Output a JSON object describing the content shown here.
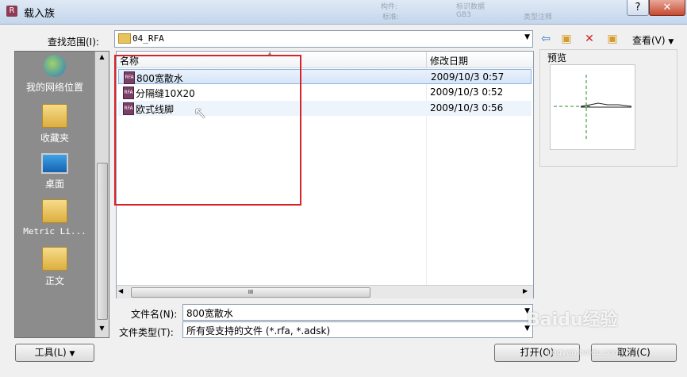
{
  "window": {
    "title": "载入族",
    "help_label": "?",
    "close_label": "✕",
    "background_text": [
      "构件:",
      "标识数据",
      "类型注释",
      "标准:",
      "GB3"
    ]
  },
  "toolbar": {
    "lookin_label": "查找范围(I):",
    "lookin_value": "04_RFA",
    "views_label": "查看(V)",
    "icons": [
      "back-icon",
      "up-folder-icon",
      "delete-icon",
      "new-folder-icon"
    ]
  },
  "places": [
    {
      "label": "我的网络位置",
      "icon": "network-globe-icon"
    },
    {
      "label": "收藏夹",
      "icon": "favorites-folder-icon"
    },
    {
      "label": "桌面",
      "icon": "desktop-monitor-icon"
    },
    {
      "label": "Metric Li...",
      "icon": "folder-icon"
    },
    {
      "label": "正文",
      "icon": "folder-icon"
    }
  ],
  "filelist": {
    "columns": [
      "名称",
      "修改日期"
    ],
    "rows": [
      {
        "name": "800宽散水",
        "date": "2009/10/3 0:57",
        "selected": true
      },
      {
        "name": "分隔缝10X20",
        "date": "2009/10/3 0:52",
        "selected": false
      },
      {
        "name": "欧式线脚",
        "date": "2009/10/3 0:56",
        "selected": false,
        "hover": true
      }
    ],
    "scroll_thumb_label": "III"
  },
  "preview": {
    "label": "预览"
  },
  "form": {
    "filename_label": "文件名(N):",
    "filename_value": "800宽散水",
    "filetype_label": "文件类型(T):",
    "filetype_value": "所有受支持的文件 (*.rfa, *.adsk)"
  },
  "buttons": {
    "tools": "工具(L)",
    "open": "打开(O)",
    "cancel": "取消(C)"
  },
  "watermark": {
    "text": "Baidu经验",
    "url": "jingyan.baidu.com"
  },
  "colors": {
    "annotation": "#d9232a",
    "selection": "#d6e6f8",
    "places_bg": "#8c8c8c"
  }
}
